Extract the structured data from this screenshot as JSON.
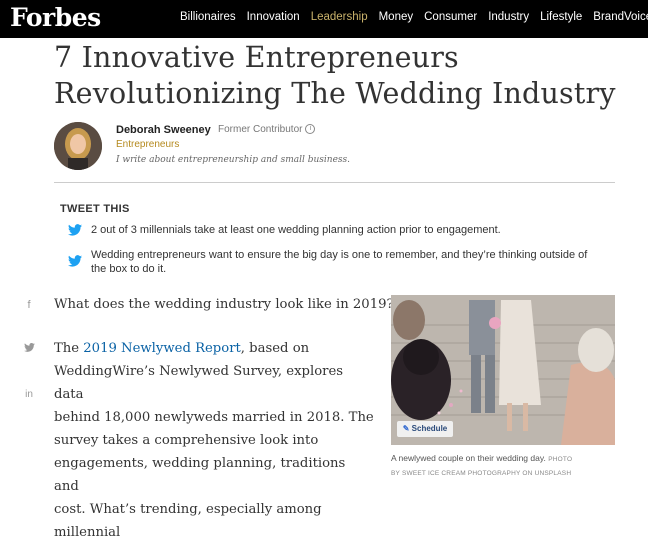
{
  "header": {
    "logo": "Forbes",
    "nav": [
      "Billionaires",
      "Innovation",
      "Leadership",
      "Money",
      "Consumer",
      "Industry",
      "Lifestyle",
      "BrandVoice"
    ],
    "active_nav": "Leadership"
  },
  "article": {
    "title": "7 Innovative Entrepreneurs Revolutionizing The Wedding Industry",
    "author": {
      "name": "Deborah Sweeney",
      "role": "Former Contributor",
      "category": "Entrepreneurs",
      "bio": "I write about entrepreneurship and small business."
    },
    "tweet_this": {
      "title": "TWEET THIS",
      "items": [
        "2 out of 3 millennials take at least one wedding planning action prior to engagement.",
        "Wedding entrepreneurs want to ensure the big day is one to remember, and they’re thinking outside of the box to do it."
      ]
    },
    "share": {
      "facebook": "f",
      "twitter": "y",
      "linkedin": "in"
    },
    "body": {
      "p1": "What does the wedding industry look like in 2019?",
      "p2_link": "2019 Newlywed Report",
      "p2_lines": [
        ", based on",
        "WeddingWire’s Newlywed Survey, explores data",
        "behind 18,000 newlyweds married in 2018. The",
        "survey takes a comprehensive look into",
        "engagements, wedding planning, traditions and",
        "cost. What’s trending, especially among millennial"
      ],
      "p2_prefix": "The "
    },
    "photo": {
      "schedule_label": "Schedule",
      "caption": "A newlywed couple on their wedding day.",
      "credit_prefix": "PHOTO",
      "credit": "BY SWEET ICE CREAM PHOTOGRAPHY ON UNSPLASH"
    }
  },
  "colors": {
    "accent_gold": "#c9b26b",
    "link_blue": "#0a62a5",
    "twitter_blue": "#1da1f2"
  }
}
